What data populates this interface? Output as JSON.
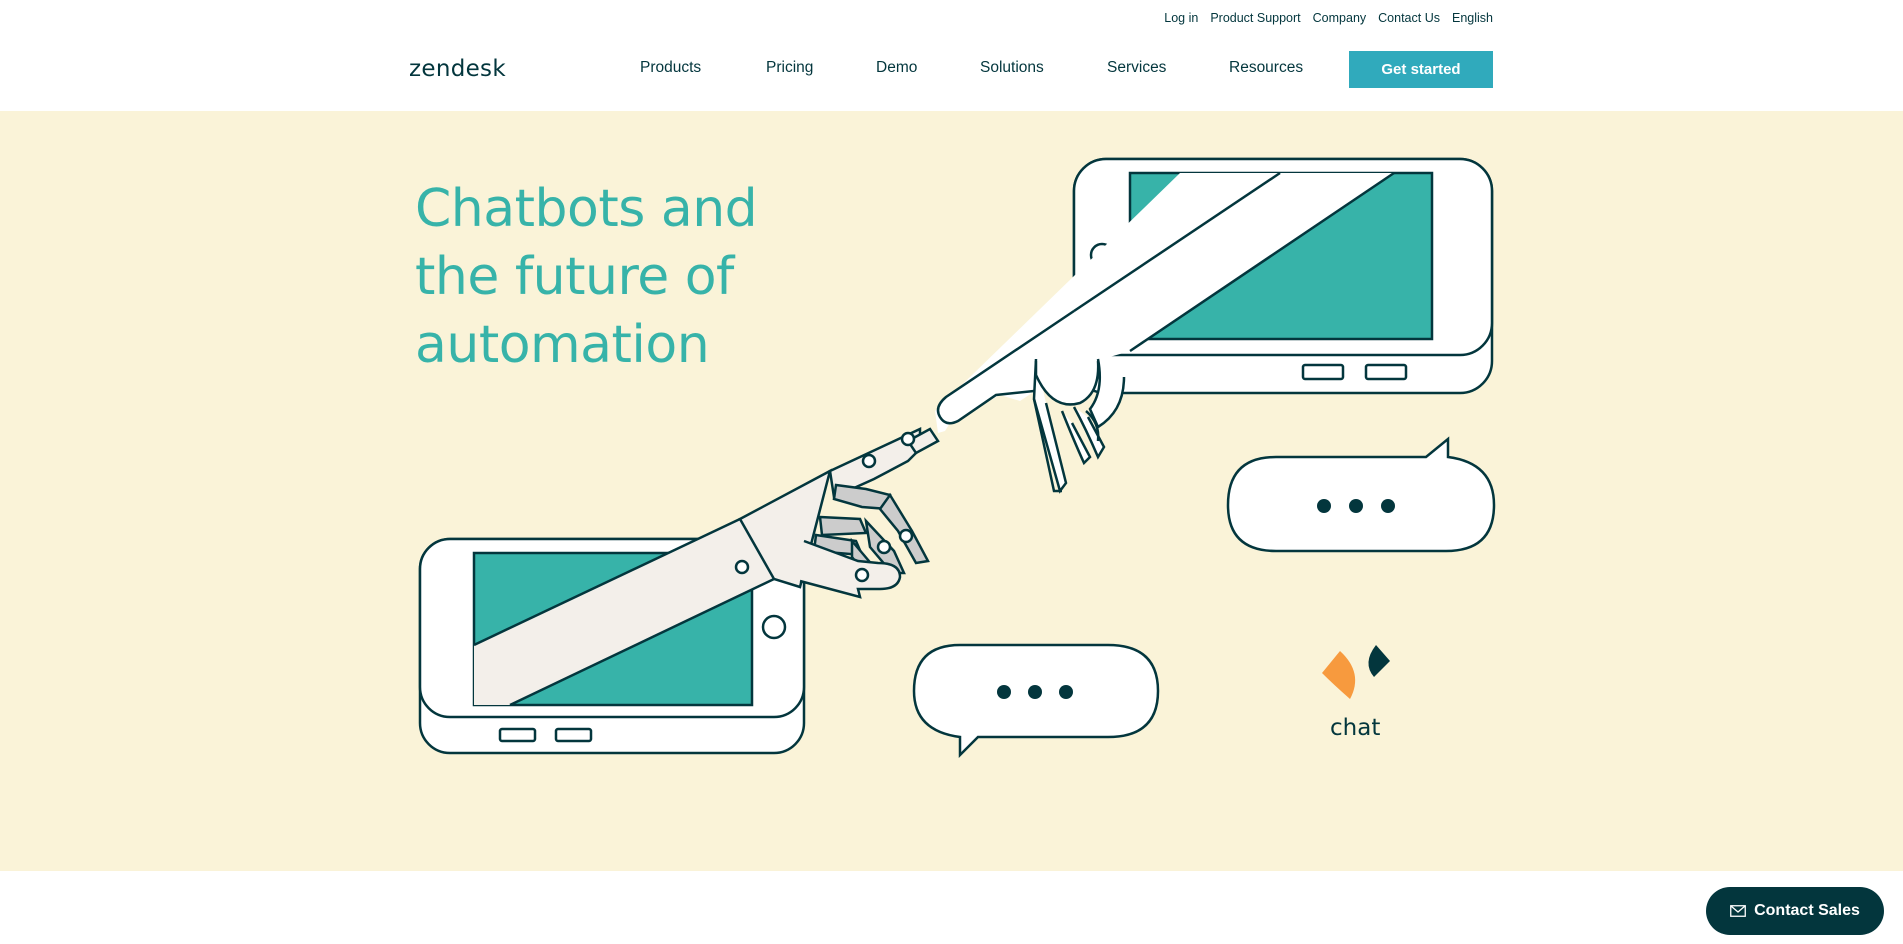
{
  "utility_nav": {
    "links": [
      {
        "label": "Log in"
      },
      {
        "label": "Product Support"
      },
      {
        "label": "Company"
      },
      {
        "label": "Contact Us"
      },
      {
        "label": "English"
      }
    ]
  },
  "header": {
    "logo": "zendesk",
    "nav": [
      {
        "label": "Products"
      },
      {
        "label": "Pricing"
      },
      {
        "label": "Demo"
      },
      {
        "label": "Solutions"
      },
      {
        "label": "Services"
      },
      {
        "label": "Resources"
      }
    ],
    "cta_label": "Get started"
  },
  "hero": {
    "title_lines": [
      "Chatbots and",
      "the future of",
      "automation"
    ],
    "chat_logo_text": "chat"
  },
  "floating": {
    "contact_sales_label": "Contact Sales",
    "icon": "mail-icon"
  },
  "colors": {
    "teal": "#37b3a9",
    "dark": "#03363d",
    "cream": "#faf3d8",
    "cta": "#30aabc",
    "orange": "#f79a3e"
  }
}
